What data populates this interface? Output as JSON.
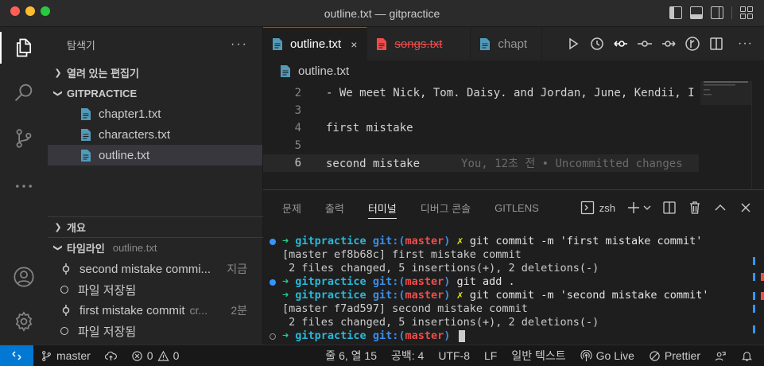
{
  "window": {
    "title": "outline.txt — gitpractice"
  },
  "sidebar": {
    "header": "탐색기",
    "more": "···",
    "open_editors": "열려 있는 편집기",
    "project": "GITPRACTICE",
    "files": [
      "chapter1.txt",
      "characters.txt",
      "outline.txt"
    ],
    "selected_file": "outline.txt",
    "outline_section": "개요",
    "timeline_section": "타임라인",
    "timeline_file": "outline.txt",
    "timeline": [
      {
        "type": "commit",
        "label": "second mistake commi...",
        "right": "지금"
      },
      {
        "type": "save",
        "label": "파일 저장됨",
        "right": ""
      },
      {
        "type": "commit",
        "label": "first mistake commit",
        "sub": "cr...",
        "right": "2분"
      },
      {
        "type": "save",
        "label": "파일 저장됨",
        "right": ""
      }
    ]
  },
  "tabs": [
    {
      "label": "outline.txt",
      "active": true,
      "close": "×"
    },
    {
      "label": "songs.txt",
      "deleted": true
    },
    {
      "label": "chapt",
      "partial": true
    }
  ],
  "breadcrumb": "outline.txt",
  "editor": {
    "lines": [
      {
        "num": "2",
        "text": "- We meet Nick, Tom. Daisy. and Jordan, June, Kendii, I"
      },
      {
        "num": "3",
        "text": ""
      },
      {
        "num": "4",
        "text": "first mistake"
      },
      {
        "num": "5",
        "text": ""
      },
      {
        "num": "6",
        "text": "second mistake",
        "blame": "You, 12초 전 • Uncommitted changes",
        "current": true
      }
    ]
  },
  "panel": {
    "tabs": [
      "문제",
      "출력",
      "터미널",
      "디버그 콘솔",
      "GITLENS"
    ],
    "active_tab": "터미널",
    "shell": "zsh",
    "terminal": [
      {
        "kind": "prompt",
        "dot": "blue",
        "arrow": "➜",
        "dir": "gitpractice",
        "git": "git:(",
        "branch": "master",
        "close": ")",
        "x": "✗",
        "cmd": "git commit -m 'first mistake commit'"
      },
      {
        "kind": "out",
        "text": "[master ef8b68c] first mistake commit"
      },
      {
        "kind": "out",
        "text": " 2 files changed, 5 insertions(+), 2 deletions(-)"
      },
      {
        "kind": "prompt",
        "dot": "blue",
        "arrow": "➜",
        "dir": "gitpractice",
        "git": "git:(",
        "branch": "master",
        "close": ")",
        "x": "",
        "cmd": "git add ."
      },
      {
        "kind": "prompt",
        "dot": "none",
        "arrow": "➜",
        "dir": "gitpractice",
        "git": "git:(",
        "branch": "master",
        "close": ")",
        "x": "✗",
        "cmd": "git commit -m 'second mistake commit'"
      },
      {
        "kind": "out",
        "text": "[master f7ad597] second mistake commit"
      },
      {
        "kind": "out",
        "text": " 2 files changed, 5 insertions(+), 2 deletions(-)"
      },
      {
        "kind": "prompt",
        "dot": "hollow",
        "arrow": "➜",
        "dir": "gitpractice",
        "git": "git:(",
        "branch": "master",
        "close": ")",
        "x": "",
        "cmd": "",
        "cursor": true
      }
    ]
  },
  "statusbar": {
    "branch": "master",
    "errors": "0",
    "warnings": "0",
    "position": "줄 6, 열 15",
    "spaces": "공백: 4",
    "encoding": "UTF-8",
    "eol": "LF",
    "language": "일반 텍스트",
    "golive": "Go Live",
    "prettier": "Prettier"
  },
  "colors": {
    "accent": "#0078d4",
    "git_branch": "#f14c4c",
    "prompt_arrow": "#23d18b",
    "folder": "#29b8db"
  }
}
